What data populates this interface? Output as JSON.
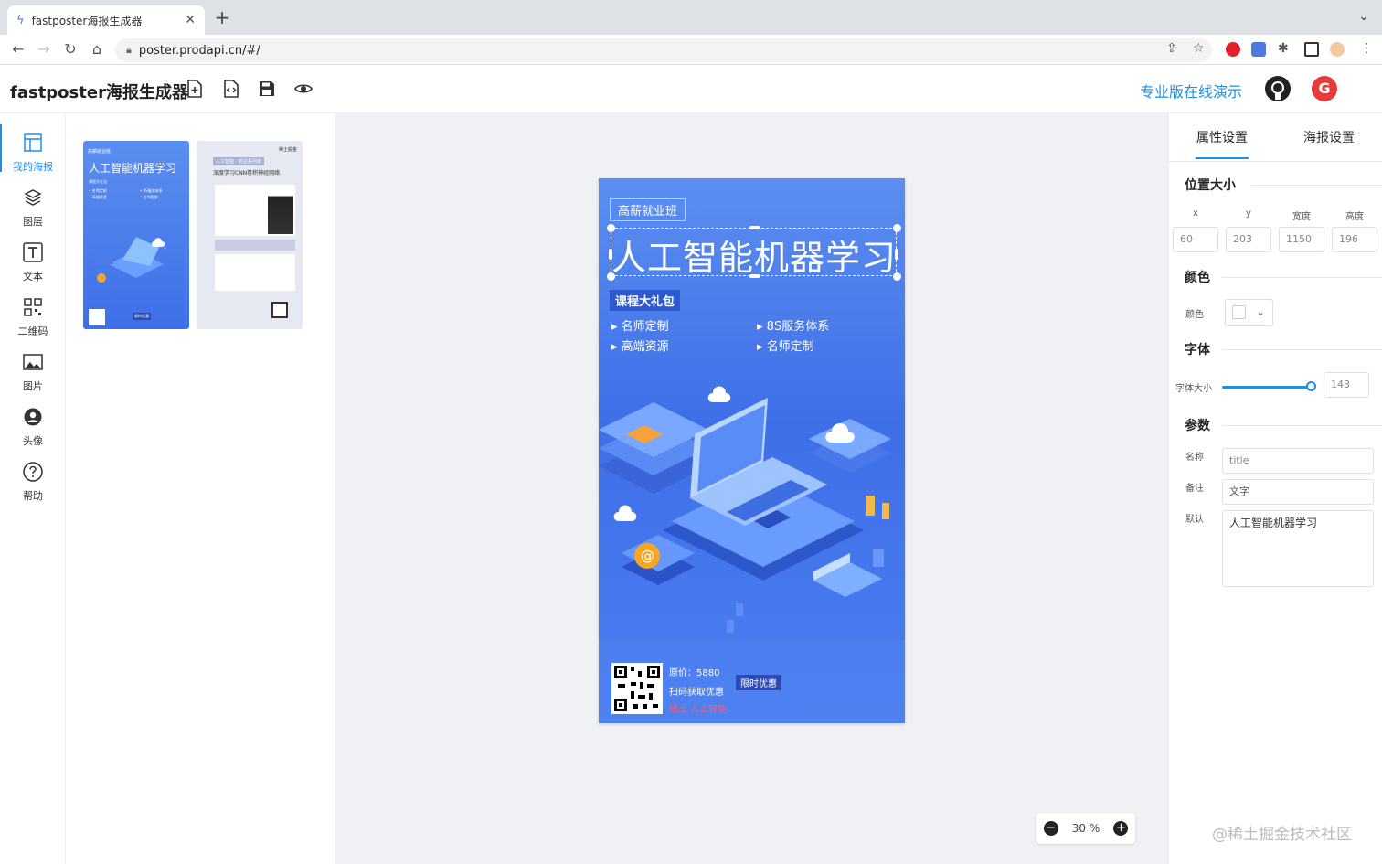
{
  "browser": {
    "tab_title": "fastposter海报生成器",
    "url": "poster.prodapi.cn/#/"
  },
  "app": {
    "title": "fastposter海报生成器",
    "pro_link": "专业版在线演示"
  },
  "sidebar": {
    "items": [
      {
        "label": "我的海报",
        "icon": "poster-layout-icon"
      },
      {
        "label": "图层",
        "icon": "layers-icon"
      },
      {
        "label": "文本",
        "icon": "text-icon"
      },
      {
        "label": "二维码",
        "icon": "qrcode-icon"
      },
      {
        "label": "图片",
        "icon": "image-icon"
      },
      {
        "label": "头像",
        "icon": "avatar-icon"
      },
      {
        "label": "帮助",
        "icon": "help-icon"
      }
    ]
  },
  "templates": {
    "t1": {
      "tag": "高薪就业班",
      "title": "人工智能机器学习",
      "gift": "课程大礼包",
      "items": [
        "• 名师定制",
        "• 8S服务体系",
        "• 高端资源",
        "• 名师定制"
      ],
      "badge": "限时优惠"
    },
    "t2": {
      "brand": "稀土掘金",
      "banner": "人工智能 · 前沿系列课",
      "title": "深度学习CNN卷积神经网络"
    }
  },
  "poster": {
    "tag": "高薪就业班",
    "title": "人工智能机器学习",
    "gift": "课程大礼包",
    "items": [
      "名师定制",
      "8S服务体系",
      "高端资源",
      "名师定制"
    ],
    "price": "原价：5880",
    "scan": "扫码获取优惠",
    "red": "稀土 人工智能",
    "badge": "限时优惠"
  },
  "zoom": {
    "value": "30 %"
  },
  "props": {
    "tab_attr": "属性设置",
    "tab_poster": "海报设置",
    "pos_section": "位置大小",
    "labels": {
      "x": "x",
      "y": "y",
      "w": "宽度",
      "h": "高度"
    },
    "values": {
      "x": "60",
      "y": "203",
      "w": "1150",
      "h": "196"
    },
    "color_section": "颜色",
    "color_label": "颜色",
    "font_section": "字体",
    "font_size_label": "字体大小",
    "font_size": "143",
    "font_size_level": 0.92,
    "param_section": "参数",
    "name_label": "名称",
    "name_value": "title",
    "note_label": "备注",
    "note_value": "文字",
    "default_label": "默认",
    "default_value": "人工智能机器学习"
  },
  "watermark": "@稀土掘金技术社区",
  "colors": {
    "accent": "#1f8ee8",
    "poster_blue": "#4a7cf0"
  }
}
